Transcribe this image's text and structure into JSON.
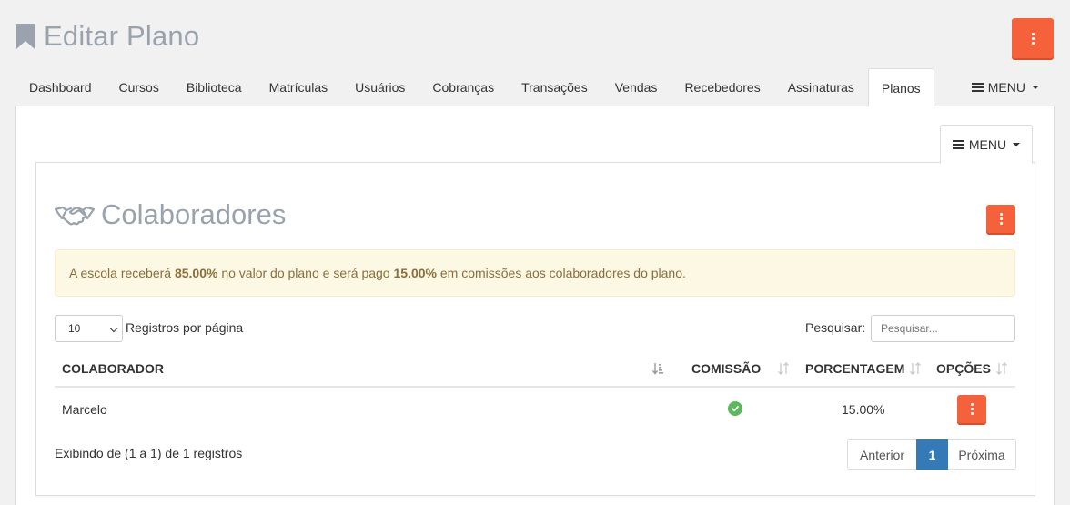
{
  "header": {
    "title": "Editar Plano",
    "icon": "bookmark-icon"
  },
  "tabs": [
    {
      "label": "Dashboard"
    },
    {
      "label": "Cursos"
    },
    {
      "label": "Biblioteca"
    },
    {
      "label": "Matrículas"
    },
    {
      "label": "Usuários"
    },
    {
      "label": "Cobranças"
    },
    {
      "label": "Transações"
    },
    {
      "label": "Vendas"
    },
    {
      "label": "Recebedores"
    },
    {
      "label": "Assinaturas"
    },
    {
      "label": "Planos",
      "active": true
    }
  ],
  "tab_menu": {
    "label": "MENU"
  },
  "inner_menu": {
    "label": "MENU"
  },
  "box": {
    "title": "Colaboradores",
    "icon": "handshake-icon"
  },
  "alert": {
    "prefix": "A escola receberá ",
    "school_pct": "85.00%",
    "middle": " no valor do plano e será pago ",
    "commission_pct": "15.00%",
    "suffix": " em comissões aos colaboradores do plano."
  },
  "length": {
    "value": "10",
    "label": "Registros por página"
  },
  "search": {
    "label": "Pesquisar:",
    "placeholder": "Pesquisar..."
  },
  "table": {
    "headers": [
      "COLABORADOR",
      "COMISSÃO",
      "PORCENTAGEM",
      "OPÇÕES"
    ],
    "rows": [
      {
        "colaborador": "Marcelo",
        "comissao": true,
        "porcentagem": "15.00%"
      }
    ]
  },
  "info": "Exibindo de (1 a 1) de 1 registros",
  "pagination": {
    "prev": "Anterior",
    "current": "1",
    "next": "Próxima"
  },
  "colors": {
    "accent": "#f4613b",
    "primary": "#337ab7",
    "success": "#5cb85c",
    "alert_bg": "#fcf8e3"
  }
}
